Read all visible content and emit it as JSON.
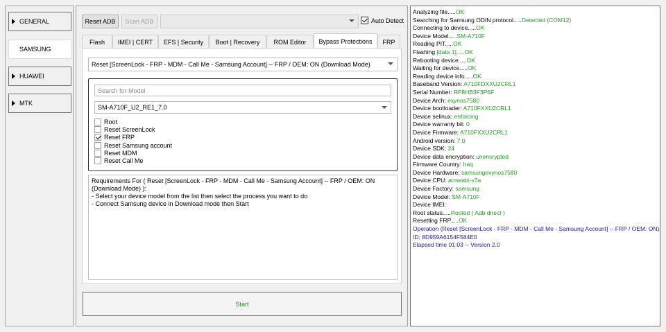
{
  "nav": {
    "items": [
      {
        "label": "GENERAL",
        "active": false
      },
      {
        "label": "SAMSUNG",
        "active": true
      },
      {
        "label": "HUAWEI",
        "active": false
      },
      {
        "label": "MTK",
        "active": false
      }
    ]
  },
  "toolbar": {
    "reset_adb": "Reset ADB",
    "scan_adb": "Scan ADB",
    "port_value": "",
    "auto_detect": "Auto Detect",
    "auto_detect_checked": true
  },
  "tabs": [
    "Flash",
    "IMEI | CERT",
    "EFS | Security",
    "Boot | Recovery",
    "ROM Editor",
    "Bypass Protections",
    "FRP"
  ],
  "active_tab": "Bypass Protections",
  "operation_select": "Reset [ScreenLock - FRP - MDM - Call Me - Samsung Account] -- FRP / OEM: ON (Download Mode)",
  "model_search_placeholder": "Search for Model",
  "model_select": "SM-A710F_U2_RE1_7.0",
  "options": [
    {
      "label": "Root",
      "checked": false
    },
    {
      "label": "Reset ScreenLock",
      "checked": false
    },
    {
      "label": "Reset FRP",
      "checked": true
    },
    {
      "label": "Reset Samsung account",
      "checked": false
    },
    {
      "label": "Reset MDM",
      "checked": false
    },
    {
      "label": "Reset Call Me",
      "checked": false
    }
  ],
  "requirements": {
    "title": "Requirements For ( Reset [ScreenLock - FRP - MDM - Call Me - Samsung Account] -- FRP / OEM: ON (Download Mode) ):",
    "line1": "- Select your device model from the list then select the process you want to do",
    "line2": "- Connect Samsung device in Download mode then Start"
  },
  "start_label": "Start",
  "log": [
    {
      "t": "Analyzing file.....",
      "v": "OK"
    },
    {
      "t": "Searching for Samsung ODIN protocol.....",
      "v": "Detected (COM12)"
    },
    {
      "t": "Connecting to device.....",
      "v": "OK"
    },
    {
      "t": "Device Model.....",
      "v": "SM-A710F"
    },
    {
      "t": "Reading PIT.....",
      "v": "OK"
    },
    {
      "t": "Flashing ",
      "v": "[data 1].....OK"
    },
    {
      "t": "Rebooting device.....",
      "v": "OK"
    },
    {
      "t": "Waiting for device.....",
      "v": "OK"
    },
    {
      "t": "Reading device info.....",
      "v": "OK"
    },
    {
      "t": "Baseband Version: ",
      "v": "A710FDXXU2CRL1"
    },
    {
      "t": "Serial Number: ",
      "v": "RF8HB3F3P6F"
    },
    {
      "t": "Device Arch: ",
      "v": "exynos7580"
    },
    {
      "t": "Device bootloader: ",
      "v": "A710FXXU2CRL1"
    },
    {
      "t": "Device selinux: ",
      "v": "enforcing"
    },
    {
      "t": "Device warranty bit: ",
      "v": "0"
    },
    {
      "t": "Device Firmware: ",
      "v": "A710FXXU2CRL1"
    },
    {
      "t": "Android version: ",
      "v": "7.0"
    },
    {
      "t": "Device SDK: ",
      "v": "24"
    },
    {
      "t": "Device data encryption: ",
      "v": "unencrypted"
    },
    {
      "t": "Firmware Country: ",
      "v": "Iraq"
    },
    {
      "t": "Device Hardware: ",
      "v": "samsungexynos7580"
    },
    {
      "t": "Device CPU: ",
      "v": "armeabi-v7a"
    },
    {
      "t": "Device Factory: ",
      "v": "samsung"
    },
    {
      "t": "Device Model: ",
      "v": "SM-A710F"
    },
    {
      "t": "Device IMEI: ",
      "v": ""
    },
    {
      "t": "Root status.....",
      "v": "Rooted ( Adb direct )"
    },
    {
      "t": "Resetting FRP.....",
      "v": "OK"
    }
  ],
  "log_blue": [
    "Operation (Reset [ScreenLock - FRP - MDM - Call Me - Samsung Account] -- FRP / OEM: ON)",
    "ID: 8D959A6154F584E0",
    "Elapsed time 01:03 -- Version 2.0"
  ]
}
